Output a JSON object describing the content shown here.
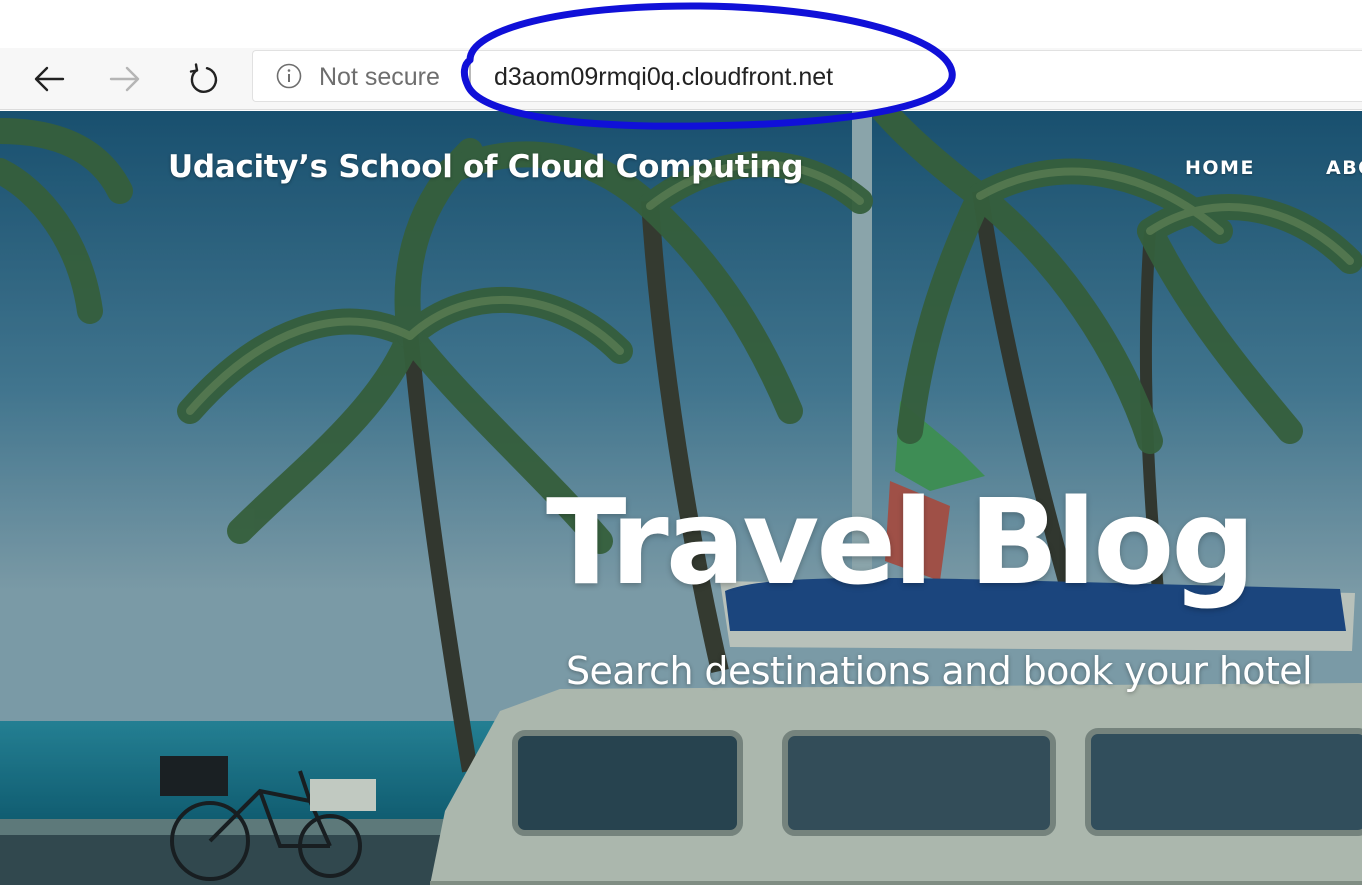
{
  "browser": {
    "security_label": "Not secure",
    "url": "d3aom09rmqi0q.cloudfront.net",
    "icons": {
      "back": "arrow-left-icon",
      "forward": "arrow-right-icon",
      "reload": "reload-icon",
      "security": "info-icon"
    },
    "annotation_color": "#1010d8"
  },
  "site": {
    "title": "Udacity’s School of Cloud Computing",
    "nav": [
      {
        "label": "HOME"
      },
      {
        "label": "ABO"
      }
    ]
  },
  "hero": {
    "heading": "Travel Blog",
    "subheading": "Search destinations and book your hotel"
  }
}
